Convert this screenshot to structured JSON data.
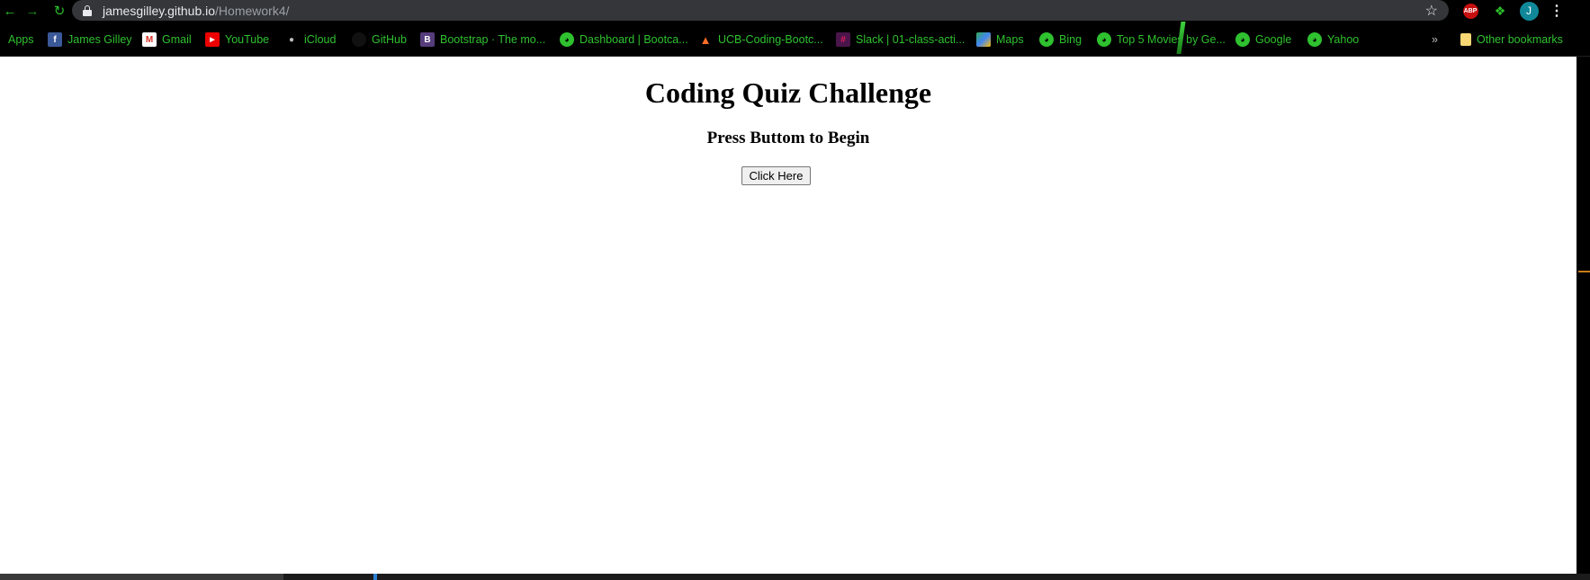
{
  "browser": {
    "url_host": "jamesgilley.github.io",
    "url_path": "/Homework4/",
    "extensions": {
      "abp_label": "ABP",
      "avatar_initial": "J"
    }
  },
  "bookmarks": [
    {
      "label": "Apps",
      "icon": "apps-grid-icon"
    },
    {
      "label": "James Gilley",
      "icon": "facebook-icon"
    },
    {
      "label": "Gmail",
      "icon": "gmail-icon"
    },
    {
      "label": "YouTube",
      "icon": "youtube-icon"
    },
    {
      "label": "iCloud",
      "icon": "apple-icon"
    },
    {
      "label": "GitHub",
      "icon": "github-icon"
    },
    {
      "label": "Bootstrap · The mo...",
      "icon": "bootstrap-icon"
    },
    {
      "label": "Dashboard | Bootca...",
      "icon": "globe-icon"
    },
    {
      "label": "UCB-Coding-Bootc...",
      "icon": "gitlab-icon"
    },
    {
      "label": "Slack | 01-class-acti...",
      "icon": "slack-icon"
    },
    {
      "label": "Maps",
      "icon": "maps-icon"
    },
    {
      "label": "Bing",
      "icon": "globe-icon"
    },
    {
      "label": "Top 5 Movies by Ge...",
      "icon": "globe-icon"
    },
    {
      "label": "Google",
      "icon": "globe-icon"
    },
    {
      "label": "Yahoo",
      "icon": "globe-icon"
    }
  ],
  "bookmarks_overflow": "»",
  "other_bookmarks": "Other bookmarks",
  "page": {
    "title": "Coding Quiz Challenge",
    "subtitle": "Press Buttom to Begin",
    "start_button": "Click Here"
  },
  "colors": {
    "accent_green": "#2fc12f",
    "omnibox_bg": "#35363a"
  }
}
